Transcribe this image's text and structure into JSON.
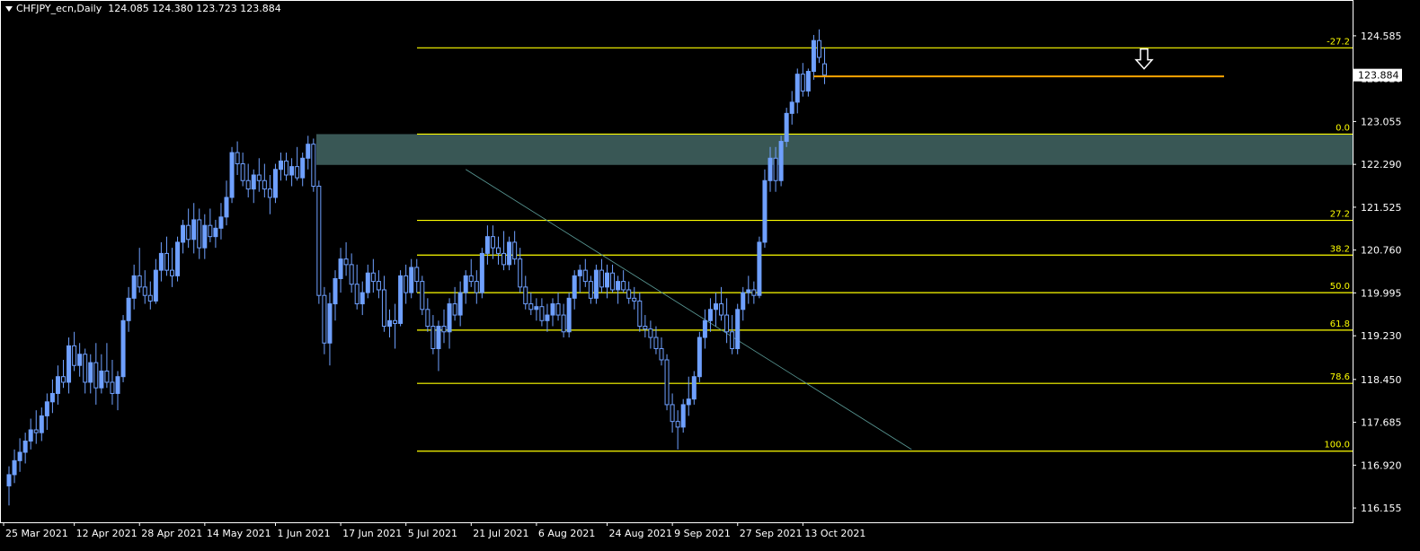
{
  "header": {
    "symbol": "CHFJPY_ecn,Daily",
    "ohlc": "124.085 124.380 123.723 123.884"
  },
  "colors": {
    "background": "#000000",
    "axis": "#ffffff",
    "bull_candle": "#6fa0ff",
    "bear_candle": "#6fa0ff",
    "fib": "#ffff00",
    "zone": "#3c5c5a",
    "resistance": "#ffa500",
    "current_price_box": "#ffffff"
  },
  "chart_data": {
    "type": "candlestick",
    "title": "CHFJPY_ecn,Daily",
    "ylim": [
      115.9,
      125.0
    ],
    "y_ticks": [
      "124.585",
      "123.820",
      "123.055",
      "122.290",
      "121.525",
      "120.760",
      "119.995",
      "119.230",
      "118.450",
      "117.685",
      "116.920",
      "116.155"
    ],
    "x_ticks": [
      "25 Mar 2021",
      "12 Apr 2021",
      "28 Apr 2021",
      "14 May 2021",
      "1 Jun 2021",
      "17 Jun 2021",
      "5 Jul 2021",
      "21 Jul 2021",
      "6 Aug 2021",
      "24 Aug 2021",
      "9 Sep 2021",
      "27 Sep 2021",
      "13 Oct 2021"
    ],
    "current_price": "123.884",
    "fib_levels": [
      {
        "label": "-27.2",
        "price": 124.37
      },
      {
        "label": "0.0",
        "price": 122.83
      },
      {
        "label": "27.2",
        "price": 121.29
      },
      {
        "label": "38.2",
        "price": 120.67
      },
      {
        "label": "50.0",
        "price": 120.0
      },
      {
        "label": "61.8",
        "price": 119.33
      },
      {
        "label": "78.6",
        "price": 118.38
      },
      {
        "label": "100.0",
        "price": 117.17
      }
    ],
    "zone": {
      "top": 122.83,
      "bottom": 122.28
    },
    "resistance_line": 123.86,
    "candles": [
      {
        "o": 116.55,
        "h": 116.9,
        "l": 116.2,
        "c": 116.75
      },
      {
        "o": 116.75,
        "h": 117.2,
        "l": 116.6,
        "c": 117.0
      },
      {
        "o": 117.0,
        "h": 117.4,
        "l": 116.8,
        "c": 117.15
      },
      {
        "o": 117.15,
        "h": 117.5,
        "l": 116.95,
        "c": 117.35
      },
      {
        "o": 117.35,
        "h": 117.75,
        "l": 117.2,
        "c": 117.55
      },
      {
        "o": 117.55,
        "h": 117.9,
        "l": 117.3,
        "c": 117.5
      },
      {
        "o": 117.5,
        "h": 117.95,
        "l": 117.35,
        "c": 117.8
      },
      {
        "o": 117.8,
        "h": 118.2,
        "l": 117.55,
        "c": 118.05
      },
      {
        "o": 118.05,
        "h": 118.45,
        "l": 117.85,
        "c": 118.2
      },
      {
        "o": 118.2,
        "h": 118.7,
        "l": 118.0,
        "c": 118.5
      },
      {
        "o": 118.5,
        "h": 118.8,
        "l": 118.3,
        "c": 118.4
      },
      {
        "o": 118.4,
        "h": 119.2,
        "l": 118.2,
        "c": 119.05
      },
      {
        "o": 119.05,
        "h": 119.3,
        "l": 118.6,
        "c": 118.7
      },
      {
        "o": 118.7,
        "h": 119.1,
        "l": 118.5,
        "c": 118.9
      },
      {
        "o": 118.9,
        "h": 119.0,
        "l": 118.2,
        "c": 118.4
      },
      {
        "o": 118.4,
        "h": 118.9,
        "l": 118.2,
        "c": 118.75
      },
      {
        "o": 118.75,
        "h": 119.1,
        "l": 118.0,
        "c": 118.3
      },
      {
        "o": 118.3,
        "h": 118.9,
        "l": 118.2,
        "c": 118.6
      },
      {
        "o": 118.6,
        "h": 119.1,
        "l": 118.3,
        "c": 118.4
      },
      {
        "o": 118.4,
        "h": 118.8,
        "l": 118.0,
        "c": 118.2
      },
      {
        "o": 118.2,
        "h": 118.6,
        "l": 117.9,
        "c": 118.5
      },
      {
        "o": 118.5,
        "h": 119.6,
        "l": 118.4,
        "c": 119.5
      },
      {
        "o": 119.5,
        "h": 120.1,
        "l": 119.3,
        "c": 119.9
      },
      {
        "o": 119.9,
        "h": 120.5,
        "l": 119.7,
        "c": 120.3
      },
      {
        "o": 120.3,
        "h": 120.8,
        "l": 120.0,
        "c": 120.1
      },
      {
        "o": 120.1,
        "h": 120.4,
        "l": 119.8,
        "c": 119.95
      },
      {
        "o": 119.95,
        "h": 120.2,
        "l": 119.7,
        "c": 119.85
      },
      {
        "o": 119.85,
        "h": 120.6,
        "l": 119.8,
        "c": 120.4
      },
      {
        "o": 120.4,
        "h": 120.9,
        "l": 120.2,
        "c": 120.7
      },
      {
        "o": 120.7,
        "h": 121.0,
        "l": 120.3,
        "c": 120.4
      },
      {
        "o": 120.4,
        "h": 120.8,
        "l": 120.1,
        "c": 120.3
      },
      {
        "o": 120.3,
        "h": 121.0,
        "l": 120.2,
        "c": 120.9
      },
      {
        "o": 120.9,
        "h": 121.3,
        "l": 120.7,
        "c": 121.2
      },
      {
        "o": 121.2,
        "h": 121.5,
        "l": 120.8,
        "c": 120.95
      },
      {
        "o": 120.95,
        "h": 121.6,
        "l": 120.7,
        "c": 121.3
      },
      {
        "o": 121.3,
        "h": 121.5,
        "l": 120.6,
        "c": 120.8
      },
      {
        "o": 120.8,
        "h": 121.4,
        "l": 120.6,
        "c": 121.2
      },
      {
        "o": 121.2,
        "h": 121.5,
        "l": 120.9,
        "c": 121.0
      },
      {
        "o": 121.0,
        "h": 121.3,
        "l": 120.8,
        "c": 121.15
      },
      {
        "o": 121.15,
        "h": 121.6,
        "l": 120.95,
        "c": 121.35
      },
      {
        "o": 121.35,
        "h": 122.0,
        "l": 121.2,
        "c": 121.7
      },
      {
        "o": 121.7,
        "h": 122.6,
        "l": 121.6,
        "c": 122.5
      },
      {
        "o": 122.5,
        "h": 122.7,
        "l": 122.1,
        "c": 122.3
      },
      {
        "o": 122.3,
        "h": 122.5,
        "l": 121.9,
        "c": 122.0
      },
      {
        "o": 122.0,
        "h": 122.3,
        "l": 121.7,
        "c": 121.85
      },
      {
        "o": 121.85,
        "h": 122.2,
        "l": 121.6,
        "c": 122.1
      },
      {
        "o": 122.1,
        "h": 122.4,
        "l": 121.8,
        "c": 122.0
      },
      {
        "o": 122.0,
        "h": 122.3,
        "l": 121.7,
        "c": 121.85
      },
      {
        "o": 121.85,
        "h": 122.1,
        "l": 121.4,
        "c": 121.7
      },
      {
        "o": 121.7,
        "h": 122.3,
        "l": 121.6,
        "c": 122.2
      },
      {
        "o": 122.2,
        "h": 122.5,
        "l": 122.0,
        "c": 122.35
      },
      {
        "o": 122.35,
        "h": 122.5,
        "l": 122.0,
        "c": 122.1
      },
      {
        "o": 122.1,
        "h": 122.4,
        "l": 121.9,
        "c": 122.25
      },
      {
        "o": 122.25,
        "h": 122.6,
        "l": 122.0,
        "c": 122.05
      },
      {
        "o": 122.05,
        "h": 122.5,
        "l": 121.9,
        "c": 122.4
      },
      {
        "o": 122.4,
        "h": 122.8,
        "l": 122.2,
        "c": 122.65
      },
      {
        "o": 122.65,
        "h": 122.75,
        "l": 121.8,
        "c": 121.9
      },
      {
        "o": 121.9,
        "h": 122.0,
        "l": 119.8,
        "c": 119.95
      },
      {
        "o": 119.95,
        "h": 120.1,
        "l": 118.9,
        "c": 119.1
      },
      {
        "o": 119.1,
        "h": 120.0,
        "l": 118.7,
        "c": 119.8
      },
      {
        "o": 119.8,
        "h": 120.4,
        "l": 119.5,
        "c": 120.25
      },
      {
        "o": 120.25,
        "h": 120.8,
        "l": 120.0,
        "c": 120.6
      },
      {
        "o": 120.6,
        "h": 120.9,
        "l": 120.3,
        "c": 120.5
      },
      {
        "o": 120.5,
        "h": 120.7,
        "l": 120.0,
        "c": 120.15
      },
      {
        "o": 120.15,
        "h": 120.5,
        "l": 119.7,
        "c": 119.8
      },
      {
        "o": 119.8,
        "h": 120.2,
        "l": 119.6,
        "c": 120.0
      },
      {
        "o": 120.0,
        "h": 120.5,
        "l": 119.9,
        "c": 120.35
      },
      {
        "o": 120.35,
        "h": 120.6,
        "l": 120.0,
        "c": 120.2
      },
      {
        "o": 120.2,
        "h": 120.4,
        "l": 119.9,
        "c": 120.05
      },
      {
        "o": 120.05,
        "h": 120.3,
        "l": 119.3,
        "c": 119.4
      },
      {
        "o": 119.4,
        "h": 119.7,
        "l": 119.2,
        "c": 119.5
      },
      {
        "o": 119.5,
        "h": 119.8,
        "l": 119.0,
        "c": 119.45
      },
      {
        "o": 119.45,
        "h": 120.4,
        "l": 119.4,
        "c": 120.3
      },
      {
        "o": 120.3,
        "h": 120.5,
        "l": 119.8,
        "c": 120.0
      },
      {
        "o": 120.0,
        "h": 120.6,
        "l": 119.9,
        "c": 120.45
      },
      {
        "o": 120.45,
        "h": 120.6,
        "l": 120.0,
        "c": 120.2
      },
      {
        "o": 120.2,
        "h": 120.3,
        "l": 119.6,
        "c": 119.7
      },
      {
        "o": 119.7,
        "h": 119.9,
        "l": 119.3,
        "c": 119.4
      },
      {
        "o": 119.4,
        "h": 119.6,
        "l": 118.9,
        "c": 119.0
      },
      {
        "o": 119.0,
        "h": 119.5,
        "l": 118.6,
        "c": 119.4
      },
      {
        "o": 119.4,
        "h": 119.7,
        "l": 119.1,
        "c": 119.3
      },
      {
        "o": 119.3,
        "h": 119.9,
        "l": 119.0,
        "c": 119.8
      },
      {
        "o": 119.8,
        "h": 120.1,
        "l": 119.5,
        "c": 119.6
      },
      {
        "o": 119.6,
        "h": 120.2,
        "l": 119.4,
        "c": 120.0
      },
      {
        "o": 120.0,
        "h": 120.4,
        "l": 119.8,
        "c": 120.3
      },
      {
        "o": 120.3,
        "h": 120.6,
        "l": 120.1,
        "c": 120.2
      },
      {
        "o": 120.2,
        "h": 120.4,
        "l": 119.8,
        "c": 120.0
      },
      {
        "o": 120.0,
        "h": 120.8,
        "l": 119.9,
        "c": 120.7
      },
      {
        "o": 120.7,
        "h": 121.2,
        "l": 120.5,
        "c": 121.0
      },
      {
        "o": 121.0,
        "h": 121.2,
        "l": 120.6,
        "c": 120.8
      },
      {
        "o": 120.8,
        "h": 121.0,
        "l": 120.5,
        "c": 120.7
      },
      {
        "o": 120.7,
        "h": 121.1,
        "l": 120.4,
        "c": 120.5
      },
      {
        "o": 120.5,
        "h": 121.0,
        "l": 120.4,
        "c": 120.9
      },
      {
        "o": 120.9,
        "h": 121.1,
        "l": 120.5,
        "c": 120.6
      },
      {
        "o": 120.6,
        "h": 120.8,
        "l": 120.0,
        "c": 120.1
      },
      {
        "o": 120.1,
        "h": 120.3,
        "l": 119.7,
        "c": 119.8
      },
      {
        "o": 119.8,
        "h": 120.0,
        "l": 119.6,
        "c": 119.7
      },
      {
        "o": 119.7,
        "h": 119.9,
        "l": 119.5,
        "c": 119.75
      },
      {
        "o": 119.75,
        "h": 119.9,
        "l": 119.4,
        "c": 119.5
      },
      {
        "o": 119.5,
        "h": 119.8,
        "l": 119.3,
        "c": 119.6
      },
      {
        "o": 119.6,
        "h": 119.9,
        "l": 119.4,
        "c": 119.8
      },
      {
        "o": 119.8,
        "h": 120.0,
        "l": 119.5,
        "c": 119.6
      },
      {
        "o": 119.6,
        "h": 119.8,
        "l": 119.2,
        "c": 119.3
      },
      {
        "o": 119.3,
        "h": 120.0,
        "l": 119.2,
        "c": 119.9
      },
      {
        "o": 119.9,
        "h": 120.4,
        "l": 119.7,
        "c": 120.3
      },
      {
        "o": 120.3,
        "h": 120.5,
        "l": 120.0,
        "c": 120.4
      },
      {
        "o": 120.4,
        "h": 120.6,
        "l": 120.1,
        "c": 120.2
      },
      {
        "o": 120.2,
        "h": 120.3,
        "l": 119.8,
        "c": 119.9
      },
      {
        "o": 119.9,
        "h": 120.5,
        "l": 119.8,
        "c": 120.4
      },
      {
        "o": 120.4,
        "h": 120.6,
        "l": 120.0,
        "c": 120.1
      },
      {
        "o": 120.1,
        "h": 120.5,
        "l": 119.9,
        "c": 120.35
      },
      {
        "o": 120.35,
        "h": 120.5,
        "l": 120.0,
        "c": 120.05
      },
      {
        "o": 120.05,
        "h": 120.3,
        "l": 119.8,
        "c": 120.2
      },
      {
        "o": 120.2,
        "h": 120.4,
        "l": 120.0,
        "c": 120.05
      },
      {
        "o": 120.05,
        "h": 120.2,
        "l": 119.8,
        "c": 119.9
      },
      {
        "o": 119.9,
        "h": 120.1,
        "l": 119.7,
        "c": 119.85
      },
      {
        "o": 119.85,
        "h": 120.0,
        "l": 119.3,
        "c": 119.4
      },
      {
        "o": 119.4,
        "h": 119.6,
        "l": 119.2,
        "c": 119.35
      },
      {
        "o": 119.35,
        "h": 119.5,
        "l": 119.0,
        "c": 119.2
      },
      {
        "o": 119.2,
        "h": 119.4,
        "l": 118.9,
        "c": 119.0
      },
      {
        "o": 119.0,
        "h": 119.2,
        "l": 118.7,
        "c": 118.8
      },
      {
        "o": 118.8,
        "h": 118.9,
        "l": 117.9,
        "c": 118.0
      },
      {
        "o": 118.0,
        "h": 118.2,
        "l": 117.5,
        "c": 117.7
      },
      {
        "o": 117.7,
        "h": 117.9,
        "l": 117.2,
        "c": 117.6
      },
      {
        "o": 117.6,
        "h": 118.1,
        "l": 117.5,
        "c": 118.0
      },
      {
        "o": 118.0,
        "h": 118.5,
        "l": 117.8,
        "c": 118.1
      },
      {
        "o": 118.1,
        "h": 118.6,
        "l": 118.0,
        "c": 118.5
      },
      {
        "o": 118.5,
        "h": 119.3,
        "l": 118.4,
        "c": 119.2
      },
      {
        "o": 119.2,
        "h": 119.7,
        "l": 119.0,
        "c": 119.5
      },
      {
        "o": 119.5,
        "h": 119.9,
        "l": 119.3,
        "c": 119.7
      },
      {
        "o": 119.7,
        "h": 120.0,
        "l": 119.4,
        "c": 119.8
      },
      {
        "o": 119.8,
        "h": 120.1,
        "l": 119.5,
        "c": 119.6
      },
      {
        "o": 119.6,
        "h": 119.9,
        "l": 119.1,
        "c": 119.3
      },
      {
        "o": 119.3,
        "h": 119.6,
        "l": 118.9,
        "c": 119.0
      },
      {
        "o": 119.0,
        "h": 119.8,
        "l": 118.9,
        "c": 119.7
      },
      {
        "o": 119.7,
        "h": 120.1,
        "l": 119.5,
        "c": 120.0
      },
      {
        "o": 120.0,
        "h": 120.3,
        "l": 119.8,
        "c": 120.05
      },
      {
        "o": 120.05,
        "h": 120.2,
        "l": 119.8,
        "c": 119.95
      },
      {
        "o": 119.95,
        "h": 121.0,
        "l": 119.9,
        "c": 120.9
      },
      {
        "o": 120.9,
        "h": 122.2,
        "l": 120.8,
        "c": 122.0
      },
      {
        "o": 122.0,
        "h": 122.6,
        "l": 121.8,
        "c": 122.4
      },
      {
        "o": 122.4,
        "h": 122.6,
        "l": 121.8,
        "c": 122.0
      },
      {
        "o": 122.0,
        "h": 122.8,
        "l": 121.9,
        "c": 122.7
      },
      {
        "o": 122.7,
        "h": 123.3,
        "l": 122.6,
        "c": 123.2
      },
      {
        "o": 123.2,
        "h": 123.6,
        "l": 123.0,
        "c": 123.4
      },
      {
        "o": 123.4,
        "h": 124.0,
        "l": 123.2,
        "c": 123.9
      },
      {
        "o": 123.9,
        "h": 124.1,
        "l": 123.5,
        "c": 123.6
      },
      {
        "o": 123.6,
        "h": 124.0,
        "l": 123.5,
        "c": 123.95
      },
      {
        "o": 123.95,
        "h": 124.6,
        "l": 123.8,
        "c": 124.5
      },
      {
        "o": 124.5,
        "h": 124.7,
        "l": 124.1,
        "c": 124.2
      },
      {
        "o": 124.085,
        "h": 124.38,
        "l": 123.723,
        "c": 123.884
      }
    ]
  }
}
